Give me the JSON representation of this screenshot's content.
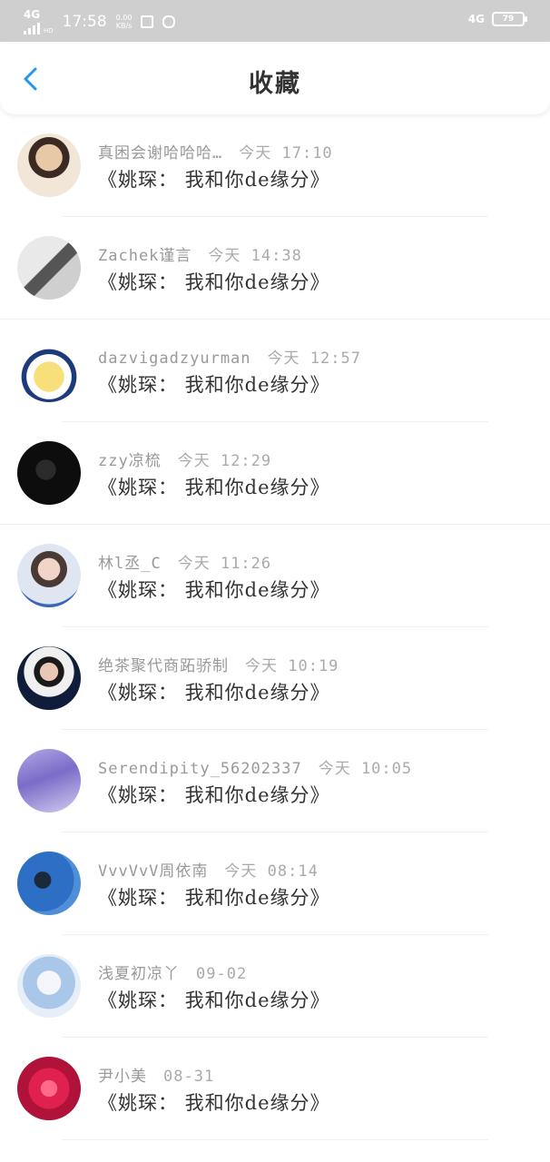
{
  "status_bar": {
    "network": "4G",
    "network_sup": "HD",
    "time": "17:58",
    "speed_value": "0.00",
    "speed_unit": "KB/s",
    "right_network": "4G",
    "battery": "79"
  },
  "header": {
    "title": "收藏",
    "back_icon": "chevron-left-icon",
    "accent_color": "#2196f3"
  },
  "items": [
    {
      "name": "真困会谢哈哈哈…",
      "time": "今天 17:10",
      "content": "《姚琛： 我和你de缘分》"
    },
    {
      "name": "Zachek谨言",
      "time": "今天 14:38",
      "content": "《姚琛： 我和你de缘分》"
    },
    {
      "name": "dazvigadzyurman",
      "time": "今天 12:57",
      "content": "《姚琛： 我和你de缘分》"
    },
    {
      "name": "zzy凉梳",
      "time": "今天 12:29",
      "content": "《姚琛： 我和你de缘分》"
    },
    {
      "name": "林l丞_C",
      "time": "今天 11:26",
      "content": "《姚琛： 我和你de缘分》"
    },
    {
      "name": "绝茶聚代商跖骄制",
      "time": "今天 10:19",
      "content": "《姚琛： 我和你de缘分》"
    },
    {
      "name": "Serendipity_56202337",
      "time": "今天 10:05",
      "content": "《姚琛： 我和你de缘分》"
    },
    {
      "name": "VvvVvV周依南",
      "time": "今天 08:14",
      "content": "《姚琛： 我和你de缘分》"
    },
    {
      "name": "浅夏初凉丫",
      "time": "09-02",
      "content": "《姚琛： 我和你de缘分》"
    },
    {
      "name": "尹小美",
      "time": "08-31",
      "content": "《姚琛： 我和你de缘分》"
    }
  ]
}
